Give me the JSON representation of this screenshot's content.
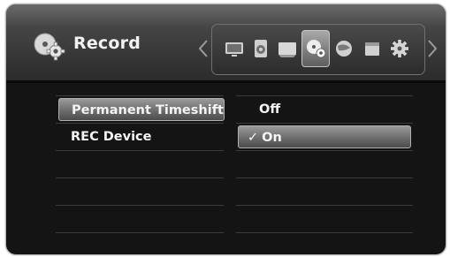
{
  "header": {
    "title": "Record",
    "title_icon": "record-gear-icon",
    "nav_prev_icon": "chevron-left-icon",
    "nav_next_icon": "chevron-right-icon",
    "icons": [
      {
        "name": "display-icon",
        "selected": false
      },
      {
        "name": "audio-icon",
        "selected": false
      },
      {
        "name": "screen-icon",
        "selected": false
      },
      {
        "name": "record-gear-icon",
        "selected": true
      },
      {
        "name": "network-icon",
        "selected": false
      },
      {
        "name": "lock-icon",
        "selected": false
      },
      {
        "name": "settings-gear-icon",
        "selected": false
      }
    ]
  },
  "menu": {
    "items": [
      {
        "label": "Permanent Timeshift",
        "highlighted": true
      },
      {
        "label": "REC Device",
        "highlighted": false
      }
    ]
  },
  "options": {
    "items": [
      {
        "label": "Off",
        "selected": false
      },
      {
        "label": "On",
        "selected": true,
        "check_mark": "✓"
      }
    ]
  },
  "colors": {
    "background": "#141414",
    "header": "#454545",
    "highlight": "#6d6d6d",
    "text": "#f4f4f4"
  }
}
